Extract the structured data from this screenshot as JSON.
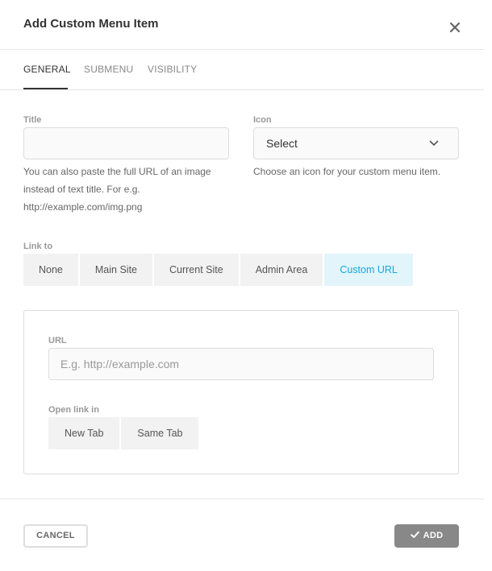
{
  "dialog": {
    "title": "Add Custom Menu Item",
    "close_icon": "close-icon"
  },
  "tabs": [
    {
      "label": "GENERAL",
      "active": true
    },
    {
      "label": "SUBMENU",
      "active": false
    },
    {
      "label": "VISIBILITY",
      "active": false
    }
  ],
  "general": {
    "title_label": "Title",
    "title_value": "",
    "title_help": [
      "You can also paste the full URL of an image",
      "instead of text title. For e.g.",
      "http://example.com/img.png"
    ],
    "icon_label": "Icon",
    "icon_select_value": "Select",
    "icon_help": "Choose an icon for your custom menu item.",
    "link_to_label": "Link to",
    "link_to_options": [
      {
        "label": "None",
        "active": false
      },
      {
        "label": "Main Site",
        "active": false
      },
      {
        "label": "Current Site",
        "active": false
      },
      {
        "label": "Admin Area",
        "active": false
      },
      {
        "label": "Custom URL",
        "active": true
      }
    ],
    "url_label": "URL",
    "url_placeholder": "E.g. http://example.com",
    "url_value": "",
    "open_link_label": "Open link in",
    "open_link_options": [
      {
        "label": "New Tab"
      },
      {
        "label": "Same Tab"
      }
    ]
  },
  "footer": {
    "cancel_label": "CANCEL",
    "add_label": "ADD",
    "add_icon": "check-icon"
  },
  "colors": {
    "accent": "#17a8e3",
    "accent_bg": "#e1f5fb",
    "add_button": "#888888"
  }
}
